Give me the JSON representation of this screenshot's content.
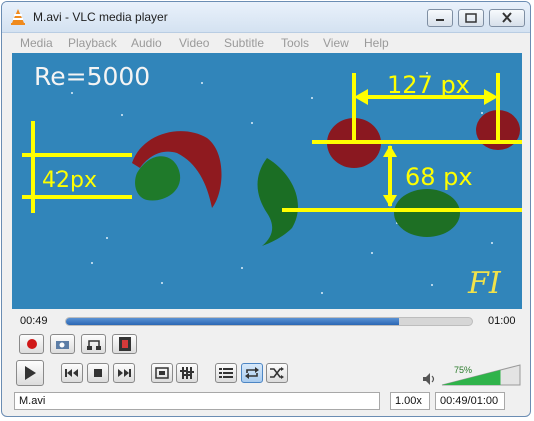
{
  "window": {
    "title": "M.avi - VLC media player"
  },
  "menu": {
    "items": [
      "Media",
      "Playback",
      "Audio",
      "Video",
      "Subtitle",
      "Tools",
      "View",
      "Help"
    ]
  },
  "video": {
    "overlay_text": "Re=5000",
    "label_42": "42px",
    "label_127": "127 px",
    "label_68": "68 px",
    "logo_text": "FI",
    "background_color": "#3185ba",
    "marker_color": "#ffff00"
  },
  "seek": {
    "elapsed": "00:49",
    "total": "01:00",
    "progress": 0.82
  },
  "controls": {
    "icons": [
      "record-icon",
      "snapshot-icon",
      "loop-ab-icon",
      "frame-step-icon",
      "play-icon",
      "previous-icon",
      "stop-icon",
      "next-icon",
      "fullscreen-icon",
      "extended-settings-icon",
      "playlist-icon",
      "loop-icon",
      "shuffle-icon",
      "speaker-icon"
    ]
  },
  "volume": {
    "percent_label": "75%",
    "level": 0.75
  },
  "status": {
    "filename": "M.avi",
    "speed": "1.00x",
    "time": "00:49/01:00"
  }
}
